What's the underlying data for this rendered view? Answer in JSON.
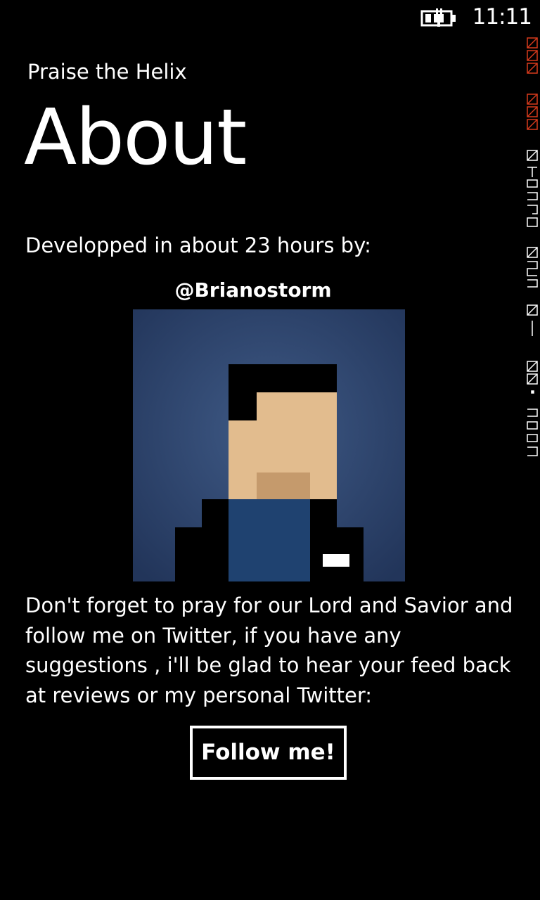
{
  "status_bar": {
    "time": "11:11",
    "battery_icon": "battery-charging-icon"
  },
  "header": {
    "app_title": "Praise the Helix",
    "page_title": "About"
  },
  "content": {
    "intro": "Developped in about 23 hours by:",
    "handle": "@Brianostorm",
    "avatar_icon": "pixel-avatar",
    "message": "Don't forget to pray for our Lord and Savior and follow me on  Twitter, if you have any suggestions , i'll be glad to hear your feed back at reviews or my personal Twitter:",
    "follow_label": "Follow me!"
  },
  "colors": {
    "background": "#000000",
    "text": "#FFFFFF",
    "avatar_bg": "#2E4468",
    "skin": "#E2BC8E",
    "shirt": "#1F4270",
    "perf_red": "#D83A1C"
  }
}
